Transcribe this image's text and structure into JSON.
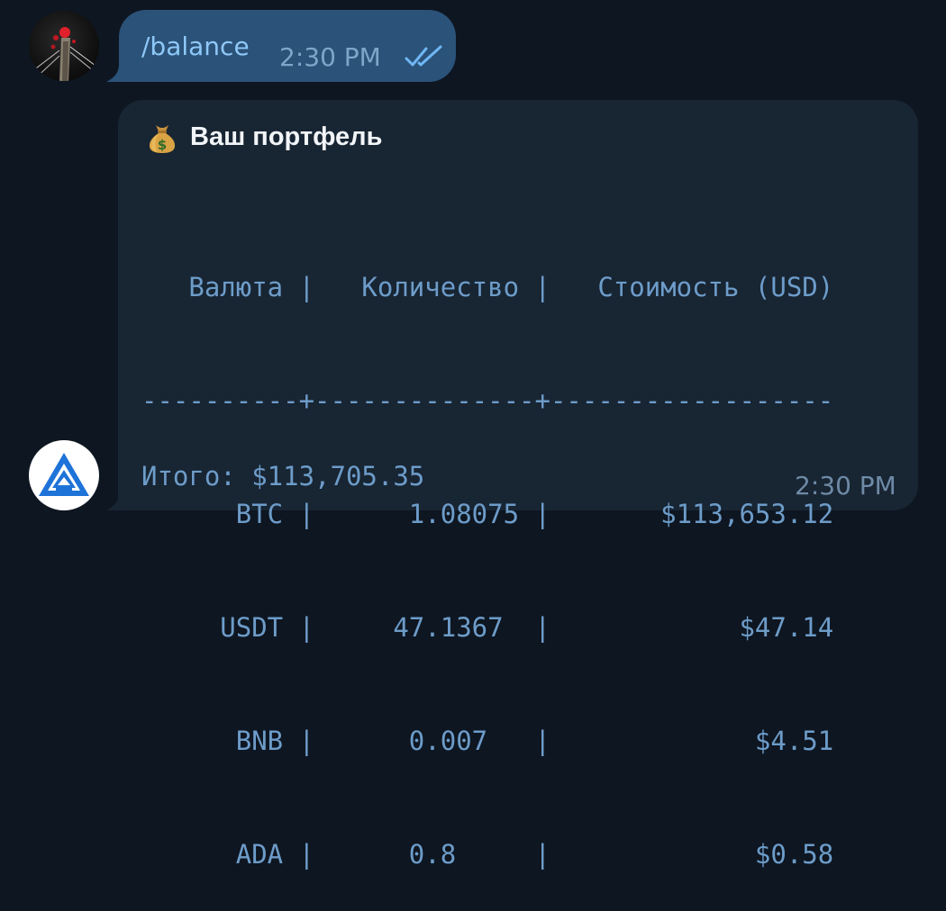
{
  "outgoing_message": {
    "text": "/balance",
    "time": "2:30 PM",
    "status_icon": "double-check-icon"
  },
  "bot_message": {
    "title_icon": "money-bag-icon",
    "title": "Ваш портфель",
    "table": {
      "header": "   Валюта |   Количество |   Стоимость (USD)",
      "separator": "----------+--------------+------------------",
      "rows": [
        "      BTC |      1.08075 |       $113,653.12",
        "     USDT |     47.1367  |            $47.14",
        "      BNB |      0.007   |             $4.51",
        "      ADA |      0.8     |             $0.58"
      ]
    },
    "total": "Итого: $113,705.35",
    "time": "2:30 PM"
  },
  "colors": {
    "background": "#0e1621",
    "outgoing_bubble": "#2b5278",
    "incoming_bubble": "#182533",
    "mono_text": "#6d9cc9",
    "link_text": "#8ec8f8"
  }
}
